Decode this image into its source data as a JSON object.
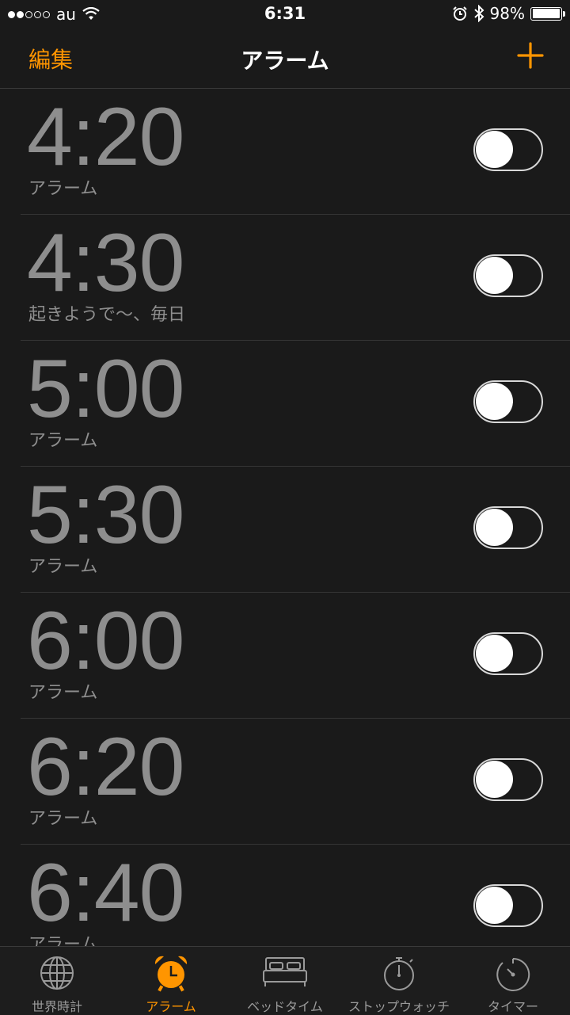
{
  "status_bar": {
    "carrier": "au",
    "time": "6:31",
    "battery_percent": "98%",
    "battery_level": 0.98,
    "signal_bars_filled": 2,
    "signal_bars_total": 5,
    "icons": [
      "wifi-icon",
      "alarm-clock-icon",
      "bluetooth-icon",
      "battery-icon"
    ]
  },
  "nav": {
    "edit_label": "編集",
    "title": "アラーム",
    "add_icon": "plus-icon"
  },
  "alarms": [
    {
      "time": "4:20",
      "label": "アラーム",
      "enabled": false
    },
    {
      "time": "4:30",
      "label": "起きようで〜、毎日",
      "enabled": false
    },
    {
      "time": "5:00",
      "label": "アラーム",
      "enabled": false
    },
    {
      "time": "5:30",
      "label": "アラーム",
      "enabled": false
    },
    {
      "time": "6:00",
      "label": "アラーム",
      "enabled": false
    },
    {
      "time": "6:20",
      "label": "アラーム",
      "enabled": false
    },
    {
      "time": "6:40",
      "label": "アラーム",
      "enabled": false
    }
  ],
  "tabs": [
    {
      "label": "世界時計",
      "icon": "globe-icon",
      "active": false
    },
    {
      "label": "アラーム",
      "icon": "alarm-clock-icon",
      "active": true
    },
    {
      "label": "ベッドタイム",
      "icon": "bed-icon",
      "active": false
    },
    {
      "label": "ストップウォッチ",
      "icon": "stopwatch-icon",
      "active": false
    },
    {
      "label": "タイマー",
      "icon": "timer-icon",
      "active": false
    }
  ],
  "colors": {
    "accent": "#ff9500",
    "background": "#1a1a1a",
    "text_dim": "#8e8e8e"
  }
}
